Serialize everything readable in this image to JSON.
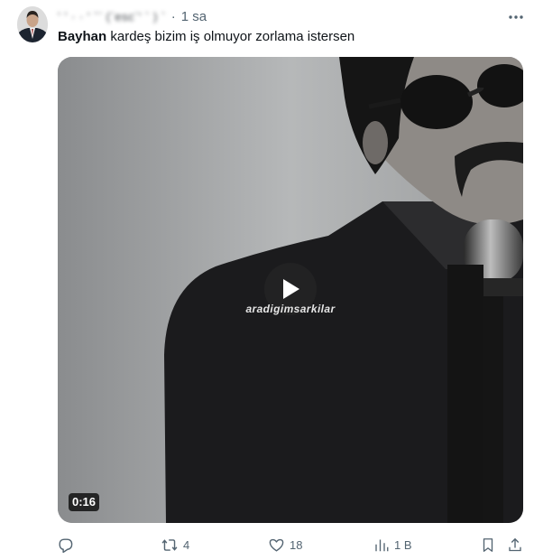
{
  "post": {
    "author_name": "ʼ  ʼ · · ' `¨ (¨esc¨ʹ ` ) ` ",
    "separator": "·",
    "time": "1 sa",
    "mention": "Bayhan",
    "text": " kardeş bizim iş olmuyor zorlama istersen"
  },
  "media": {
    "watermark": "aradigimsarkilar",
    "duration": "0:16"
  },
  "actions": {
    "reposts": "4",
    "likes": "18",
    "views": "1 B"
  },
  "icons": {
    "more": "more-horizontal-icon",
    "reply": "reply-icon",
    "repost": "repost-icon",
    "like": "heart-icon",
    "views": "views-chart-icon",
    "bookmark": "bookmark-icon",
    "share": "share-icon",
    "play": "play-icon"
  },
  "colors": {
    "text": "#0f1419",
    "secondary": "#536471"
  }
}
